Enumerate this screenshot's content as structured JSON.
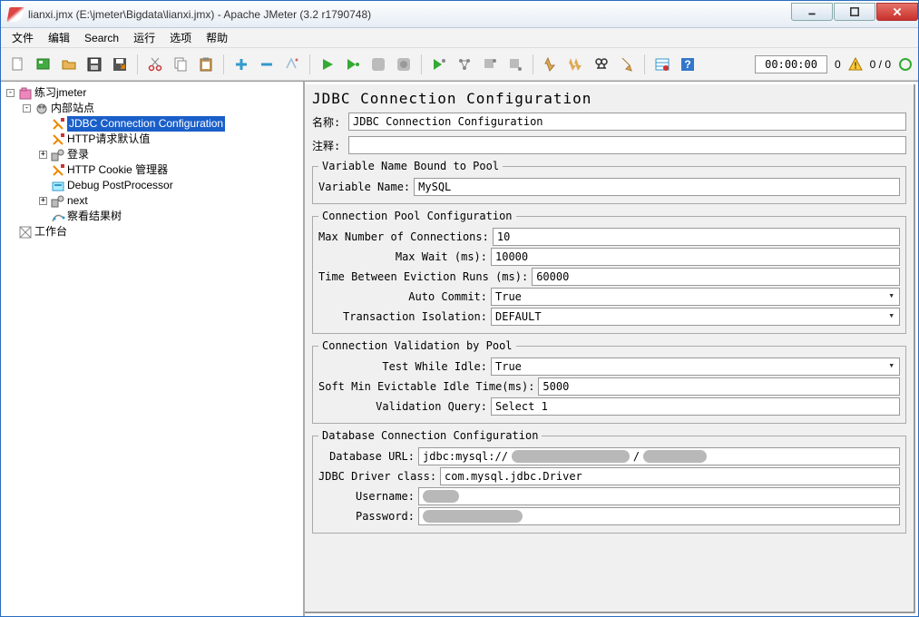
{
  "window": {
    "title": "lianxi.jmx (E:\\jmeter\\Bigdata\\lianxi.jmx) - Apache JMeter (3.2 r1790748)"
  },
  "menu": {
    "file": "文件",
    "edit": "编辑",
    "search": "Search",
    "run": "运行",
    "options": "选项",
    "help": "帮助"
  },
  "status": {
    "time": "00:00:00",
    "warn": "0",
    "ratio": "0 / 0"
  },
  "tree": {
    "root": "练习jmeter",
    "site": "内部站点",
    "jdbc": "JDBC Connection Configuration",
    "httpdef": "HTTP请求默认值",
    "login": "登录",
    "cookie": "HTTP Cookie 管理器",
    "debug": "Debug PostProcessor",
    "next": "next",
    "view": "察看结果树",
    "workbench": "工作台"
  },
  "form": {
    "title": "JDBC Connection Configuration",
    "nameLabel": "名称:",
    "name": "JDBC Connection Configuration",
    "commentLabel": "注释:",
    "comment": "",
    "g1": {
      "legend": "Variable Name Bound to Pool",
      "varNameLabel": "Variable Name:",
      "varName": "MySQL"
    },
    "g2": {
      "legend": "Connection Pool Configuration",
      "maxConnLabel": "Max Number of Connections:",
      "maxConn": "10",
      "maxWaitLabel": "Max Wait (ms):",
      "maxWait": "10000",
      "evictLabel": "Time Between Eviction Runs (ms):",
      "evict": "60000",
      "autoCommitLabel": "Auto Commit:",
      "autoCommit": "True",
      "txnIsoLabel": "Transaction Isolation:",
      "txnIso": "DEFAULT"
    },
    "g3": {
      "legend": "Connection Validation by Pool",
      "testIdleLabel": "Test While Idle:",
      "testIdle": "True",
      "softMinLabel": "Soft Min Evictable Idle Time(ms):",
      "softMin": "5000",
      "valQueryLabel": "Validation Query:",
      "valQuery": "Select 1"
    },
    "g4": {
      "legend": "Database Connection Configuration",
      "dbUrlLabel": "Database URL:",
      "dbUrlPrefix": "jdbc:mysql://",
      "driverLabel": "JDBC Driver class:",
      "driver": "com.mysql.jdbc.Driver",
      "userLabel": "Username:",
      "passLabel": "Password:"
    }
  }
}
